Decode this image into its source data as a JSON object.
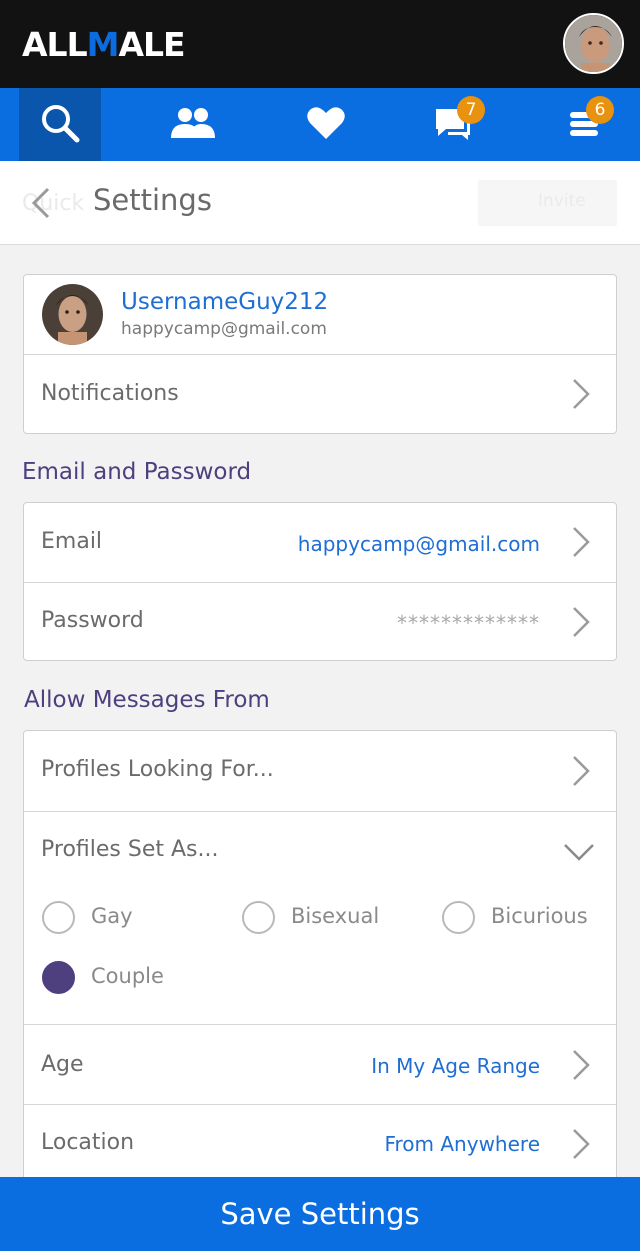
{
  "app": {
    "logo_part1": "ALL",
    "logo_mark": "M",
    "logo_part2": "ALE"
  },
  "nav": {
    "messages_badge": "7",
    "menu_badge": "6"
  },
  "subheader": {
    "ghost_left": "Quick",
    "ghost_button": "Invite"
  },
  "page": {
    "title": "Settings"
  },
  "profile": {
    "username": "UsernameGuy212",
    "email": "happycamp@gmail.com"
  },
  "rows": {
    "notifications": "Notifications"
  },
  "sections": {
    "email_password": "Email and Password",
    "allow_messages": "Allow Messages From"
  },
  "account": {
    "email_label": "Email",
    "email_value": "happycamp@gmail.com",
    "password_label": "Password",
    "password_value": "*************"
  },
  "messages": {
    "looking_for": "Profiles Looking For...",
    "set_as": "Profiles Set As...",
    "options": [
      {
        "label": "Gay",
        "checked": false
      },
      {
        "label": "Bisexual",
        "checked": false
      },
      {
        "label": "Bicurious",
        "checked": false
      },
      {
        "label": "Couple",
        "checked": true
      }
    ],
    "age_label": "Age",
    "age_value": "In My Age Range",
    "location_label": "Location",
    "location_value": "From Anywhere"
  },
  "save_label": "Save Settings",
  "colors": {
    "brand_blue": "#0b6ee0",
    "accent_purple": "#4e3f7e",
    "badge_orange": "#e8920f",
    "link_blue": "#1f6ed3"
  },
  "icons": [
    "search-icon",
    "people-icon",
    "heart-icon",
    "chat-icon",
    "menu-icon",
    "chevron-right-icon",
    "chevron-down-icon",
    "chevron-left-icon"
  ]
}
